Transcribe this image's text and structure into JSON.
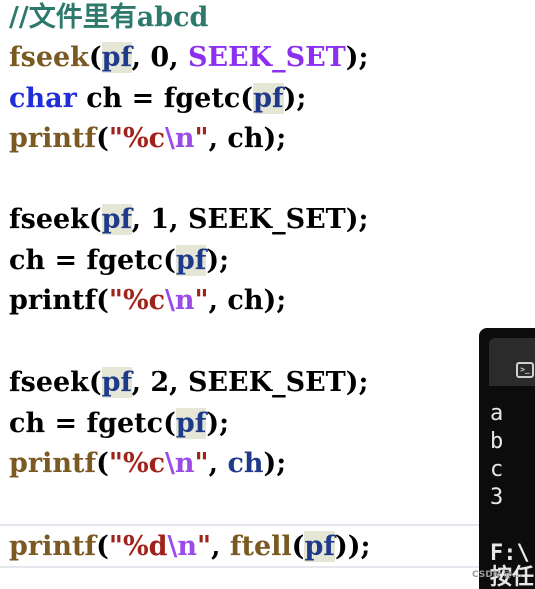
{
  "code": {
    "comment": "//文件里有abcd",
    "lines": {
      "l2": {
        "fn": "fseek",
        "open": "(",
        "pf": "pf",
        "rest1": ", 0, ",
        "macro": "SEEK_SET",
        "close": ");"
      },
      "l3": {
        "kw": "char",
        "mid": " ch = fgetc(",
        "pf": "pf",
        "close": ");"
      },
      "l4": {
        "fn": "printf",
        "open": "(",
        "q1": "\"",
        "fmt": "%c",
        "esc": "\\n",
        "q2": "\"",
        "rest": ", ch);"
      },
      "l5": {
        "fn": "fseek",
        "open": "(",
        "pf": "pf",
        "rest": ", 1, SEEK_SET);"
      },
      "l6": {
        "pre": "ch = fgetc(",
        "pf": "pf",
        "close": ");"
      },
      "l7": {
        "fn": "printf",
        "open": "(",
        "q1": "\"",
        "fmt": "%c",
        "esc": "\\n",
        "q2": "\"",
        "rest": ", ch);"
      },
      "l8": {
        "fn": "fseek",
        "open": "(",
        "pf": "pf",
        "rest": ", 2, SEEK_SET);"
      },
      "l9": {
        "pre": "ch = fgetc(",
        "pf": "pf",
        "close": ");"
      },
      "l10": {
        "fn": "printf",
        "open": "(",
        "q1": "\"",
        "fmt": "%c",
        "esc": "\\n",
        "q2": "\"",
        "comma": ", ",
        "var": "ch",
        "close": ");"
      },
      "l11": {
        "fn": "printf",
        "open": "(",
        "q1": "\"",
        "fmt": "%d",
        "esc": "\\n",
        "q2": "\"",
        "comma": ", ",
        "fn2": "ftell",
        "open2": "(",
        "pf": "pf",
        "close": "));"
      }
    }
  },
  "console": {
    "output_lines": [
      "a",
      "b",
      "c",
      "3"
    ],
    "path": "F:\\",
    "hint": "按任"
  },
  "watermark": "CSDN @...",
  "colors": {
    "comment": "#2d7a6c",
    "function": "#7a5a22",
    "keyword": "#1f2ed8",
    "macro": "#8b2ff0",
    "string": "#a0231b",
    "escape": "#9b4be8",
    "variable_highlight_bg": "#e5e6d6",
    "console_bg": "#0c0c0c"
  },
  "icons": {
    "console_tab": "terminal-icon"
  }
}
